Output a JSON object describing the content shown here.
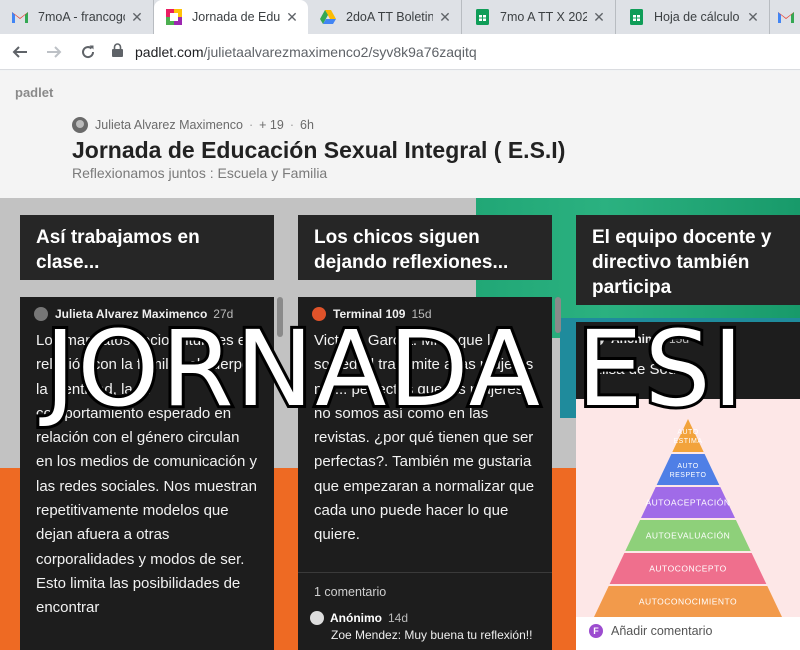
{
  "browser": {
    "tabs": [
      {
        "title": "7moA - francogc",
        "icon": "gmail-icon"
      },
      {
        "title": "Jornada de Educ",
        "icon": "padlet-icon"
      },
      {
        "title": "2doA TT Boletin",
        "icon": "drive-icon"
      },
      {
        "title": "7mo A TT X 202",
        "icon": "sheets-icon"
      },
      {
        "title": "Hoja de cálculo",
        "icon": "sheets-icon"
      },
      {
        "title": "M",
        "icon": "gmail-icon"
      }
    ],
    "url_host": "padlet.com",
    "url_path": "/julietaalvarezmaximenco2/syv8k9a76zaqitq"
  },
  "page": {
    "logo": "padlet",
    "author": "Julieta Alvarez Maximenco",
    "likes": "+ 19",
    "age": "6h",
    "title": "Jornada de Educación Sexual Integral ( E.S.I)",
    "subtitle": "Reflexionamos juntos : Escuela y Familia",
    "overlay_text": "JORNADA ESI",
    "columns": [
      {
        "heading": "Así trabajamos en clase..."
      },
      {
        "heading": "Los chicos siguen dejando reflexiones..."
      },
      {
        "heading": "El equipo docente y directivo también participa"
      }
    ],
    "posts": [
      {
        "author": "Julieta Alvarez Maximenco",
        "age": "27d",
        "body": "Los mandatos socioculturales en relación con la familia, el cuerpo, la identidad, la fa comportamiento esperado en relación con el género circulan en los medios de comunicación y las redes sociales. Nos muestran repetitivamente modelos que dejan afuera a otras corporalidades y modos de ser. Esto limita las posibilidades de encontrar"
      },
      {
        "author": "Terminal 109",
        "age": "15d",
        "body": "Victoria García. Mi ... que la sociedad transmite a las mujeres no ... perfectas que las mujeres no somos así como en las revistas. ¿por qué tienen que ser perfectas?. También me gustaria que empezaran a normalizar que cada uno puede hacer lo que quiere.",
        "comments_count": "1 comentario",
        "comment_author": "Anónimo",
        "comment_age": "14d",
        "comment_text": "Zoe Mendez: Muy buena tu reflexión!!"
      },
      {
        "author": "Anónimo",
        "age": "15d",
        "body": "Elisa de Souza",
        "add_comment": "Añadir comentario"
      }
    ],
    "pyramid": [
      "AUTO ESTIMA",
      "AUTO RESPETO",
      "AUTOACEPTACIÓN",
      "AUTOEVALUACIÓN",
      "AUTOCONCEPTO",
      "AUTOCONOCIMIENTO"
    ],
    "pyramid_colors": [
      "#f2a33b",
      "#4f7fe6",
      "#a06be8",
      "#8ed07a",
      "#ef6f8d",
      "#f29a4b"
    ]
  }
}
